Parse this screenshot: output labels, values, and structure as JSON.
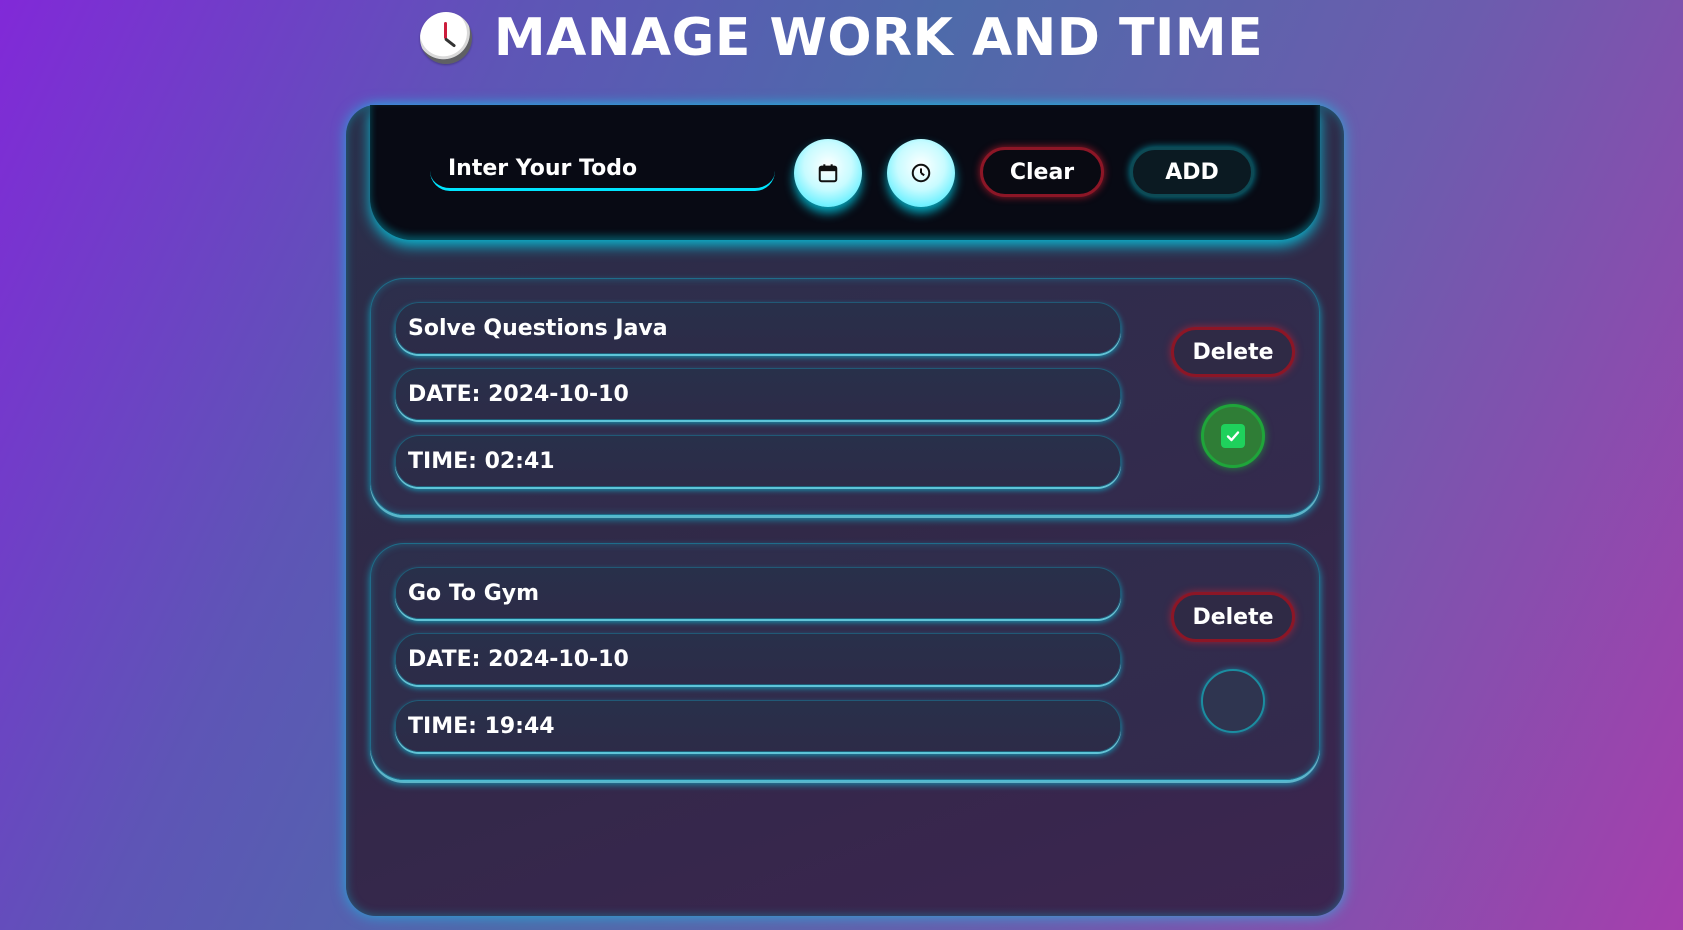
{
  "header": {
    "icon": "clock-icon",
    "title": "MANAGE WORK AND TIME"
  },
  "toolbar": {
    "input_placeholder": "Inter Your Todo",
    "input_value": "",
    "calendar_icon": "calendar-icon",
    "clock_icon": "clock-icon",
    "clear_label": "Clear",
    "add_label": "ADD"
  },
  "todos": [
    {
      "title": "Solve Questions Java",
      "date": "DATE: 2024-10-10",
      "time": "TIME: 02:41",
      "delete_label": "Delete",
      "completed": true
    },
    {
      "title": "Go To Gym",
      "date": "DATE: 2024-10-10",
      "time": "TIME: 19:44",
      "delete_label": "Delete",
      "completed": false
    }
  ],
  "colors": {
    "accent": "#00e5ff",
    "danger": "#8c1626",
    "success": "#1fd15c"
  }
}
